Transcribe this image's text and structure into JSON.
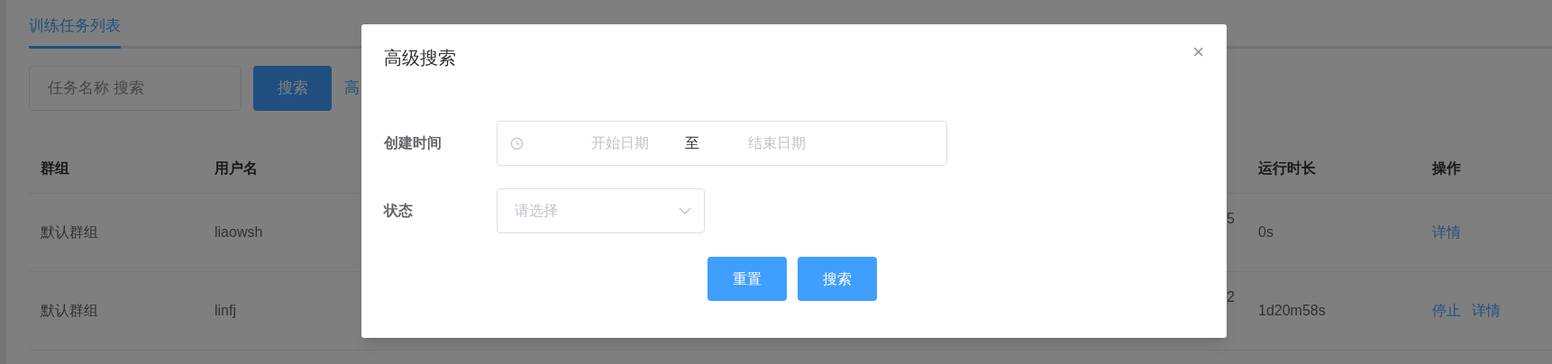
{
  "tabs": [
    {
      "label": "训练任务列表",
      "selected": true
    }
  ],
  "search": {
    "placeholder": "任务名称 搜索",
    "button": "搜索",
    "advanced_link": "高"
  },
  "table": {
    "columns": [
      "群组",
      "用户名",
      "",
      "运行时长",
      "操作"
    ],
    "rows": [
      {
        "cells": [
          "默认群组",
          "liaowsh",
          "5",
          "0s"
        ],
        "actions": [
          "详情"
        ]
      },
      {
        "cells": [
          "默认群组",
          "linfj",
          "2",
          "1d20m58s"
        ],
        "actions": [
          "停止",
          "详情"
        ]
      }
    ]
  },
  "dialog": {
    "title": "高级搜索",
    "close": "×",
    "fields": [
      {
        "kind": "daterange",
        "label": "创建时间",
        "start_placeholder": "开始日期",
        "separator": "至",
        "end_placeholder": "结束日期"
      },
      {
        "kind": "select",
        "label": "状态",
        "placeholder": "请选择"
      }
    ],
    "buttons": [
      "重置",
      "搜索"
    ]
  }
}
